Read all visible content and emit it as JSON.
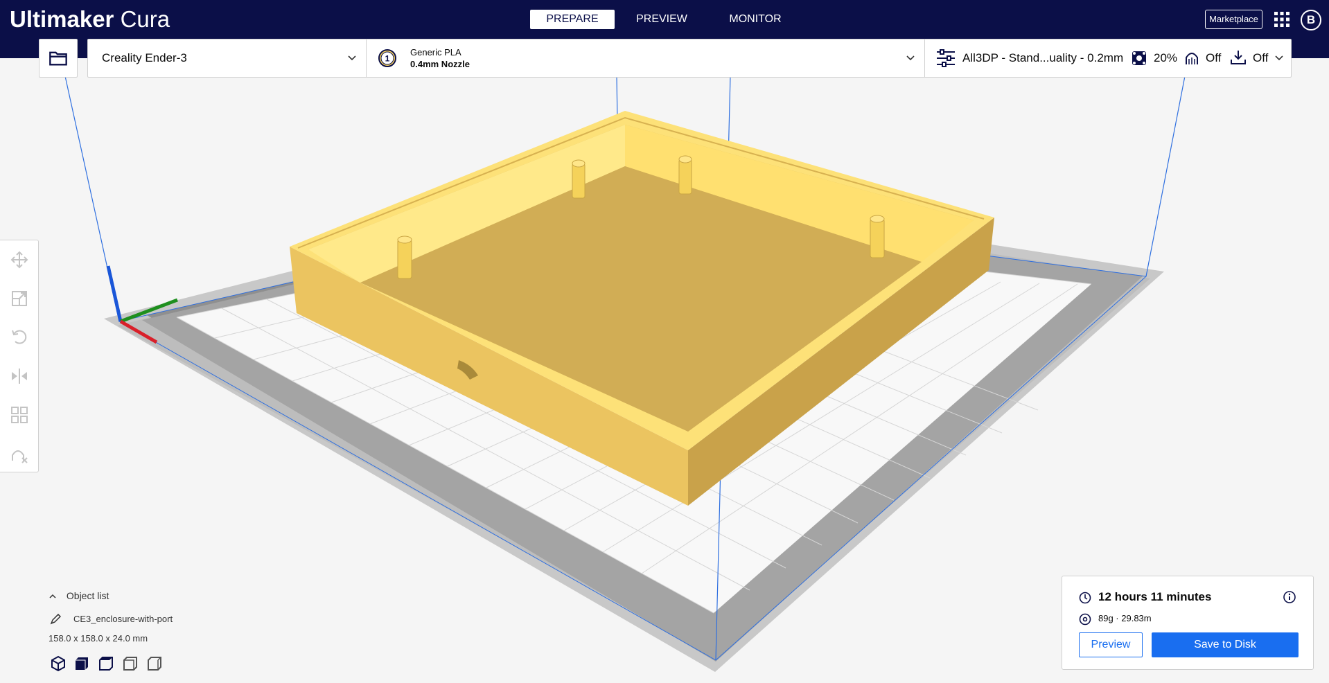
{
  "app": {
    "brand_bold": "Ultimaker",
    "brand_light": "Cura"
  },
  "stages": [
    {
      "label": "PREPARE",
      "active": true
    },
    {
      "label": "PREVIEW",
      "active": false
    },
    {
      "label": "MONITOR",
      "active": false
    }
  ],
  "header": {
    "marketplace_label": "Marketplace",
    "avatar_initial": "B"
  },
  "toolbar": {
    "printer": "Creality Ender-3",
    "extruder_number": "1",
    "material": "Generic PLA",
    "nozzle": "0.4mm Nozzle",
    "profile": "All3DP - Stand...uality - 0.2mm",
    "infill": "20%",
    "support": "Off",
    "adhesion": "Off"
  },
  "tools": [
    "move-tool-icon",
    "scale-tool-icon",
    "rotate-tool-icon",
    "mirror-tool-icon",
    "per-model-settings-icon",
    "support-blocker-icon"
  ],
  "object_list": {
    "toggle_label": "Object list",
    "object_name": "CE3_enclosure-with-port",
    "dimensions": "158.0 x 158.0 x 24.0 mm"
  },
  "print_info": {
    "time": "12 hours 11 minutes",
    "material_usage": "89g · 29.83m",
    "preview_label": "Preview",
    "save_label": "Save to Disk"
  },
  "colors": {
    "header_bg": "#0b0f48",
    "accent": "#196ef0",
    "model": "#f9d55f",
    "build_plate_border": "#999999"
  }
}
